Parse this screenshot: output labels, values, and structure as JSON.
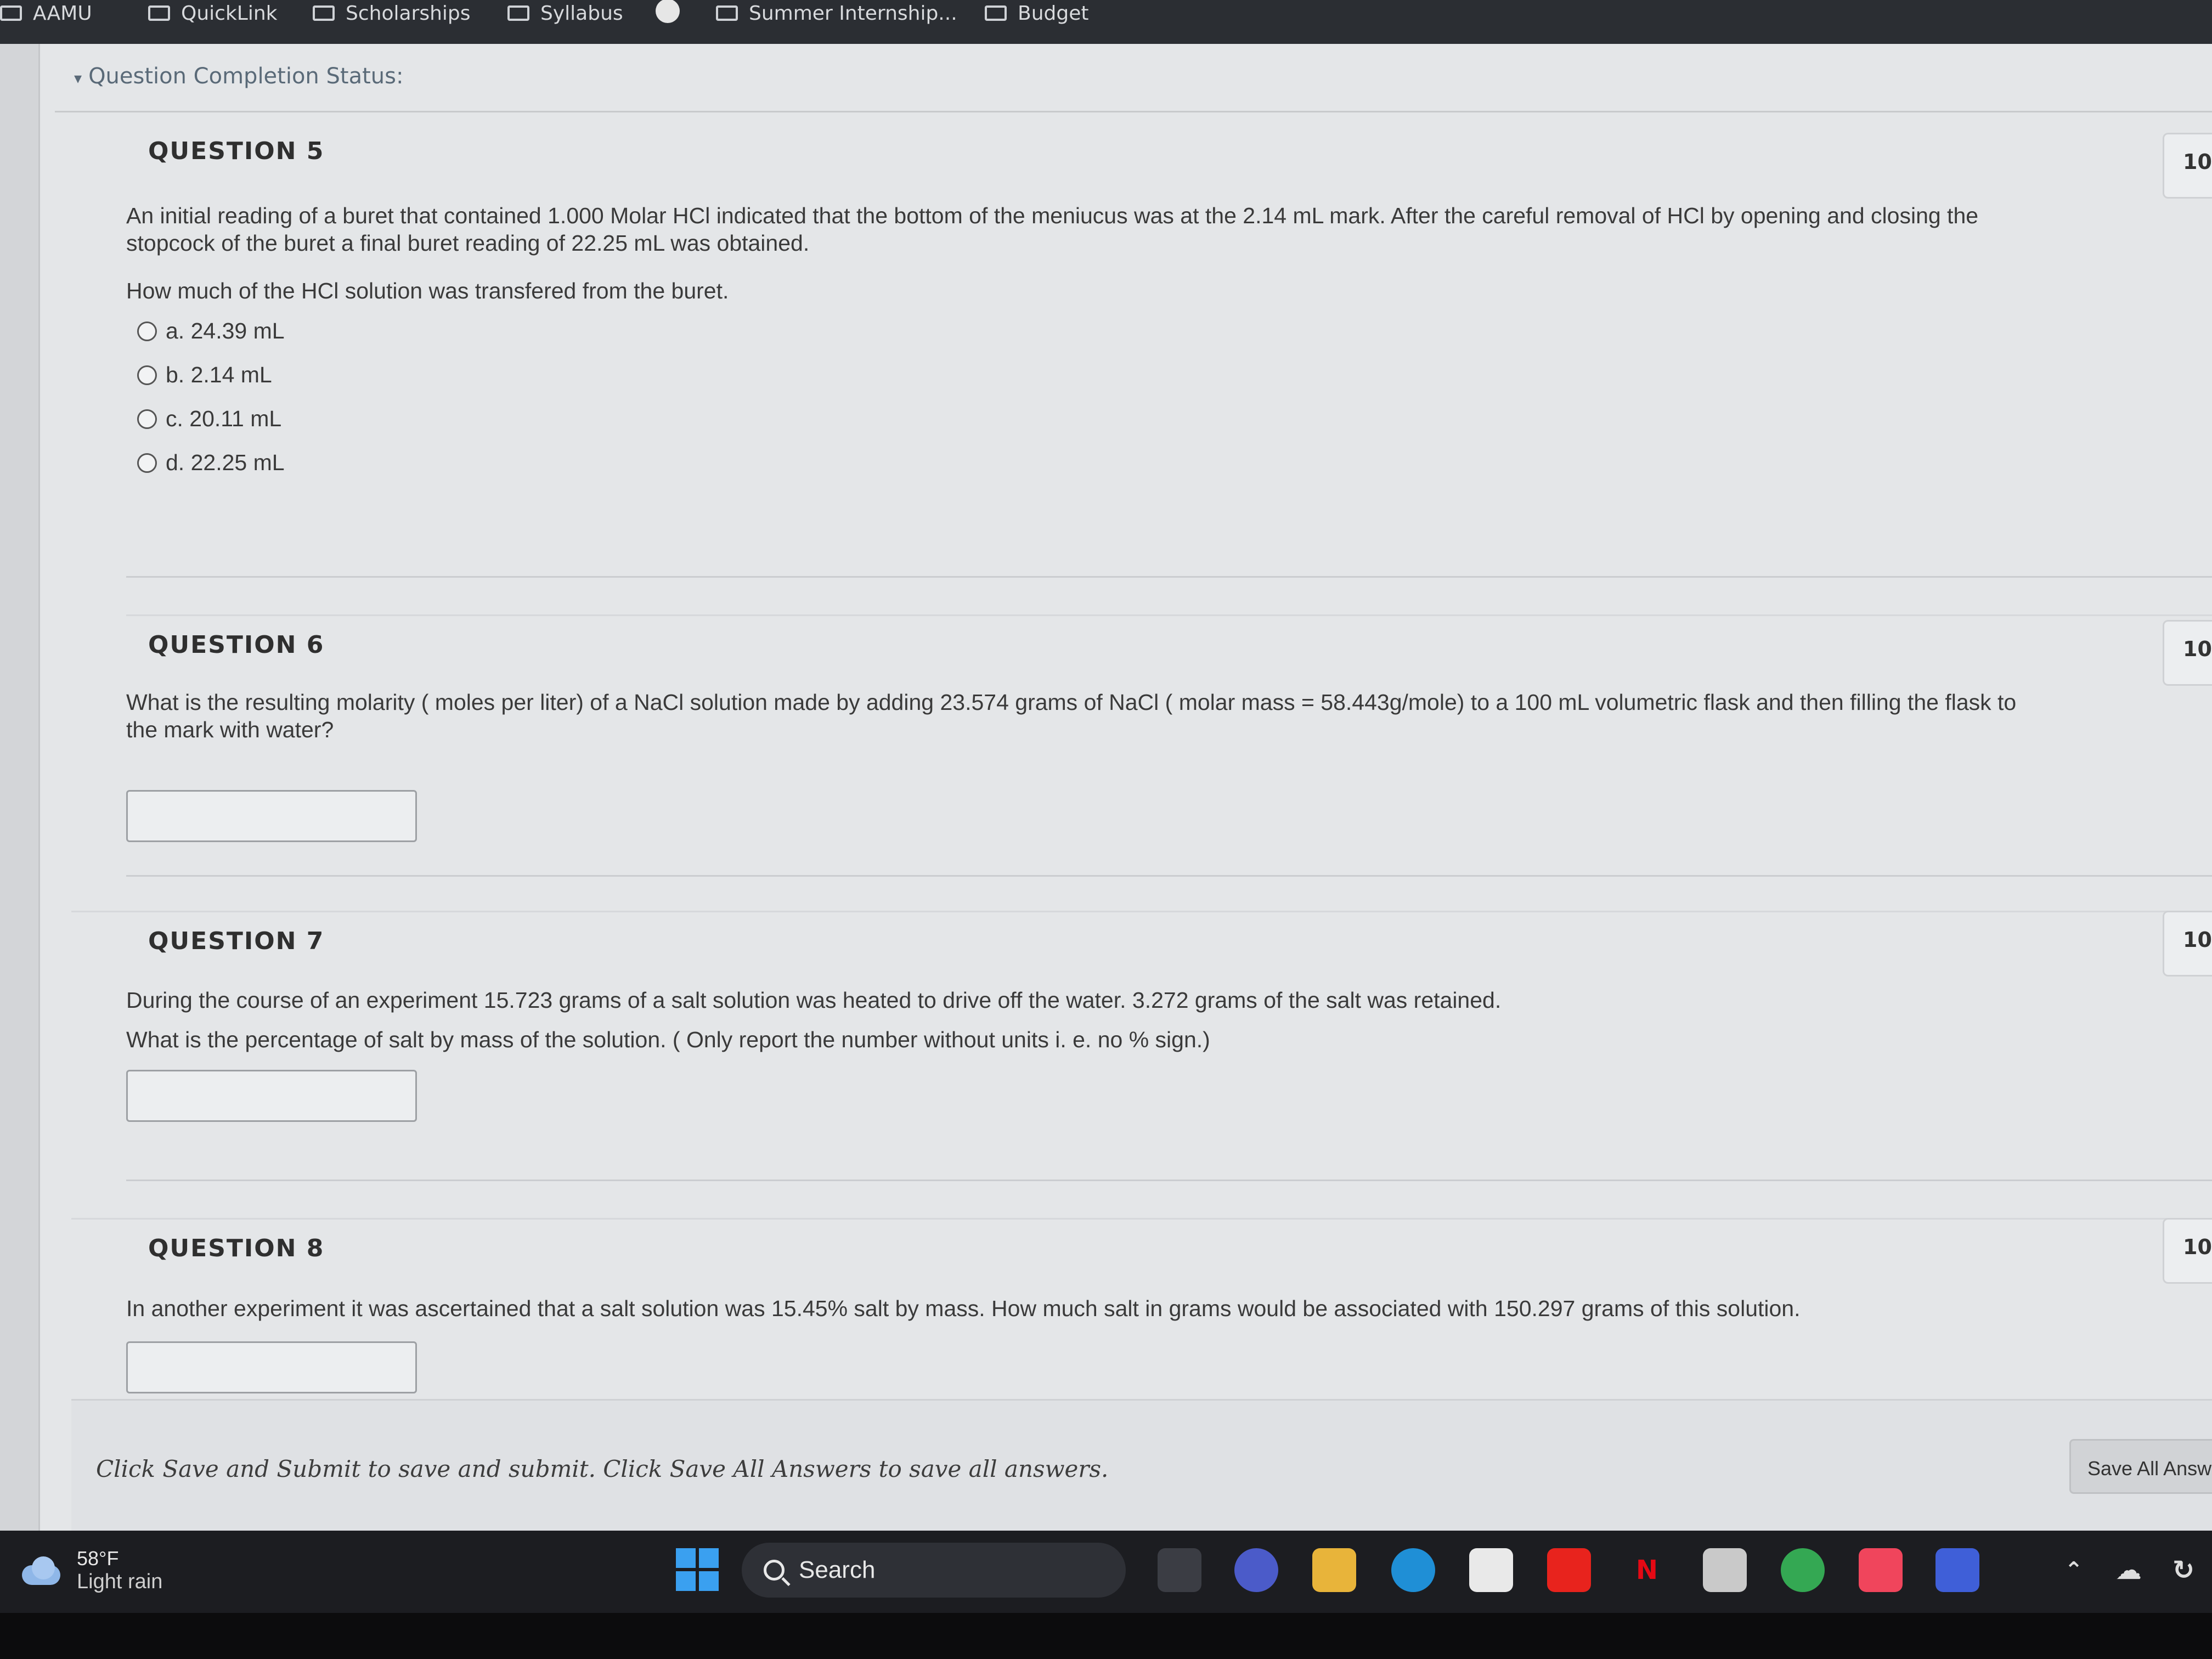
{
  "bookmarks": [
    "AAMU",
    "QuickLink",
    "Scholarships",
    "Syllabus",
    "Summer Internship...",
    "Budget"
  ],
  "status_header": "Question Completion Status:",
  "questions": [
    {
      "title": "QUESTION 5",
      "points": "10",
      "text": "An initial reading of a buret that contained 1.000 Molar HCl indicated that the bottom of the meniucus was at the 2.14 mL mark.  After the careful removal of HCl by opening and closing the stopcock of the buret a final buret reading of 22.25 mL was obtained.",
      "prompt": "How much of the HCl solution was transfered from the buret.",
      "options": [
        "a. 24.39 mL",
        "b. 2.14 mL",
        "c. 20.11 mL",
        "d. 22.25 mL"
      ]
    },
    {
      "title": "QUESTION 6",
      "points": "10",
      "text": "What is the resulting molarity ( moles per liter) of a NaCl solution made by adding 23.574 grams of NaCl ( molar mass = 58.443g/mole) to a 100 mL volumetric flask and then filling the flask to the mark with water?",
      "answer_value": ""
    },
    {
      "title": "QUESTION 7",
      "points": "10",
      "text": "During the course of an experiment 15.723 grams of a salt solution was heated to drive off the water.  3.272 grams of the salt was retained.",
      "prompt": "What is the percentage of salt by mass of the solution.  ( Only report the number without units i. e.  no % sign.)",
      "answer_value": ""
    },
    {
      "title": "QUESTION 8",
      "points": "10",
      "text": "In another experiment it was ascertained that a salt solution was 15.45% salt by mass.   How much salt in grams would be associated with 150.297 grams of this solution.",
      "answer_value": ""
    }
  ],
  "footer": {
    "instructions": "Click Save and Submit to save and submit. Click Save All Answers to save all answers.",
    "save_all_label": "Save All Answers"
  },
  "taskbar": {
    "weather_temp": "58°F",
    "weather_desc": "Light rain",
    "search_label": "Search",
    "netflix_glyph": "N"
  },
  "colors": {
    "accent_blue": "#3aa0f0",
    "youtube_red": "#e8231d",
    "netflix_red": "#e50914",
    "music_red": "#f0455c"
  }
}
